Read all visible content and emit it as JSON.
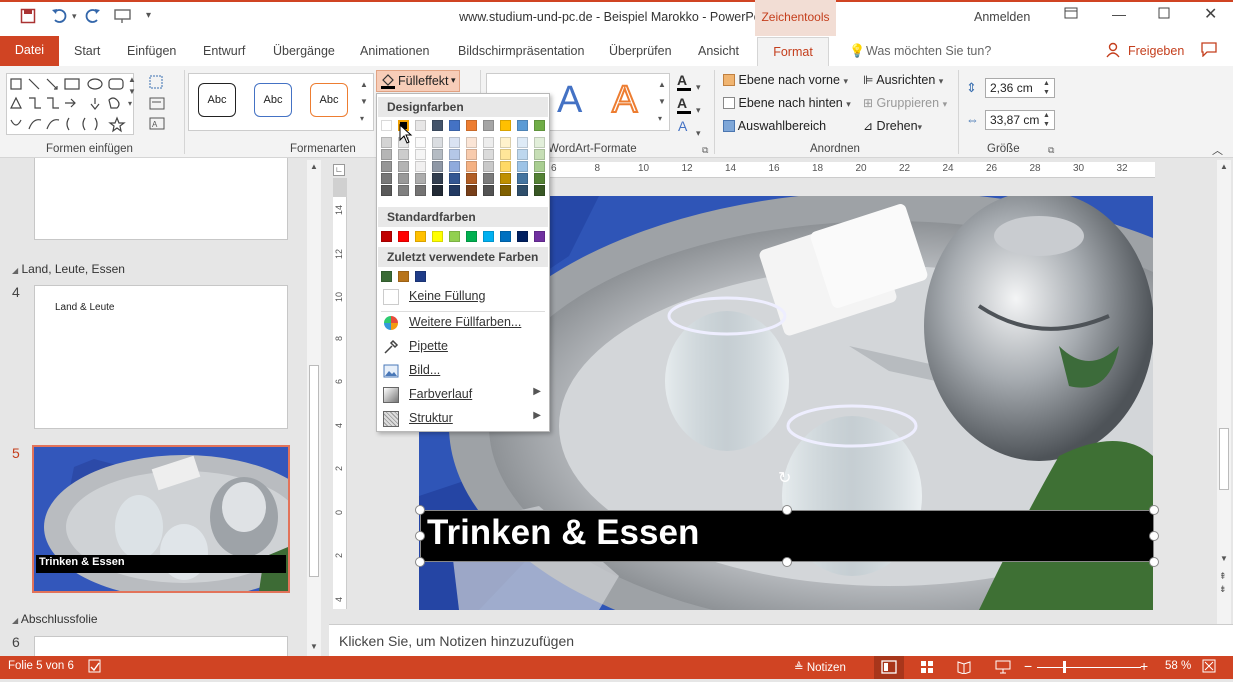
{
  "window": {
    "title": "www.studium-und-pc.de - Beispiel Marokko  -  PowerPoint",
    "contextual_tab": "Zeichentools",
    "signin": "Anmelden"
  },
  "tabs": [
    "Datei",
    "Start",
    "Einfügen",
    "Entwurf",
    "Übergänge",
    "Animationen",
    "Bildschirmpräsentation",
    "Überprüfen",
    "Ansicht",
    "Format"
  ],
  "tellme": "Was möchten Sie tun?",
  "share": "Freigeben",
  "ribbon": {
    "groups": {
      "shapes": "Formen einfügen",
      "styles": "Formenarten",
      "wordart": "WordArt-Formate",
      "arrange": "Anordnen",
      "size": "Größe"
    },
    "fill_button": "Fülleffekt",
    "style_sample": "Abc",
    "arrange": {
      "forward": "Ebene nach vorne",
      "backward": "Ebene nach hinten",
      "selection": "Auswahlbereich",
      "align": "Ausrichten",
      "group": "Gruppieren",
      "rotate": "Drehen"
    },
    "size": {
      "height": "2,36  cm",
      "width": "33,87  cm"
    }
  },
  "fill_menu": {
    "theme_header": "Designfarben",
    "standard_header": "Standardfarben",
    "recent_header": "Zuletzt verwendete Farben",
    "no_fill": "Keine Füllung",
    "more": "Weitere Füllfarben...",
    "eyedropper": "Pipette",
    "picture": "Bild...",
    "gradient": "Farbverlauf",
    "texture": "Struktur",
    "theme_colors": [
      "#ffffff",
      "#000000",
      "#e7e6e6",
      "#44546a",
      "#4472c4",
      "#ed7d31",
      "#a5a5a5",
      "#ffc000",
      "#5b9bd5",
      "#70ad47"
    ],
    "standard_colors": [
      "#c00000",
      "#ff0000",
      "#ffc000",
      "#ffff00",
      "#92d050",
      "#00b050",
      "#00b0f0",
      "#0070c0",
      "#002060",
      "#7030a0"
    ],
    "recent_colors": [
      "#3a6b35",
      "#b8741a",
      "#1f3c88"
    ]
  },
  "thumbs": {
    "section1": "Land, Leute, Essen",
    "section2": "Abschlussfolie",
    "slide4_num": "4",
    "slide4_title": "Land & Leute",
    "slide5_num": "5",
    "slide5_title": "Trinken & Essen",
    "slide6_num": "6"
  },
  "ruler": {
    "h": [
      "6",
      "8",
      "10",
      "12",
      "14",
      "16",
      "18",
      "20",
      "22",
      "24",
      "26",
      "28",
      "30",
      "32"
    ],
    "v": [
      "14",
      "12",
      "10",
      "8",
      "6",
      "4",
      "2",
      "0",
      "2",
      "4"
    ]
  },
  "slide": {
    "title": "Trinken & Essen"
  },
  "notes_placeholder": "Klicken Sie, um Notizen hinzuzufügen",
  "status": {
    "slide_of": "Folie 5 von 6",
    "notes": "Notizen",
    "zoom": "58 %"
  }
}
